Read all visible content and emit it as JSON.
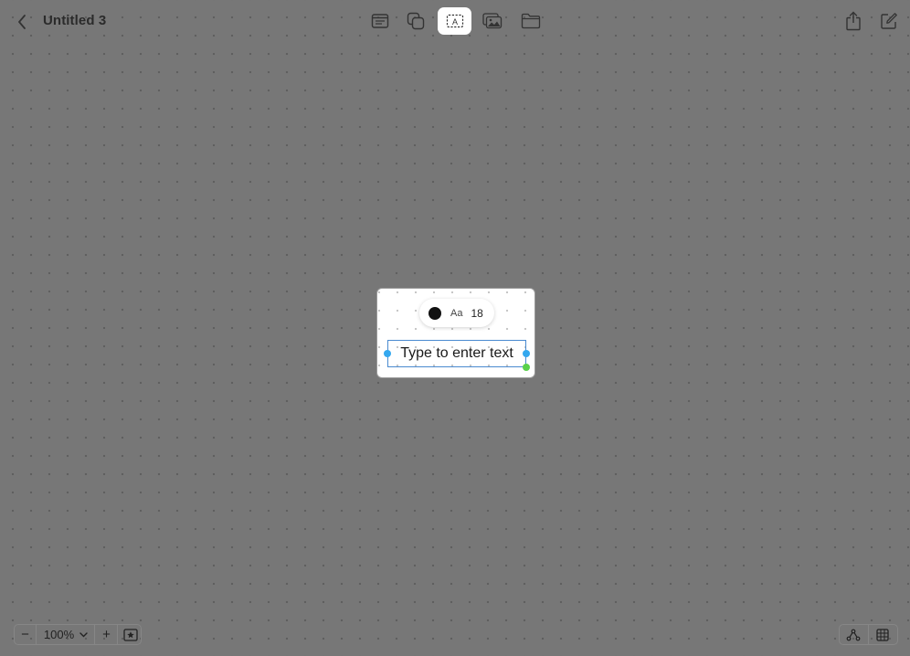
{
  "header": {
    "title": "Untitled 3",
    "tools": [
      {
        "name": "notes-tool",
        "icon": "text-page-icon",
        "active": false
      },
      {
        "name": "shapes-tool",
        "icon": "shapes-icon",
        "active": false
      },
      {
        "name": "text-box-tool",
        "icon": "text-box-icon",
        "active": true
      },
      {
        "name": "media-tool",
        "icon": "photo-icon",
        "active": false
      },
      {
        "name": "files-tool",
        "icon": "folder-icon",
        "active": false
      }
    ],
    "right_icons": [
      "share-icon",
      "compose-icon"
    ]
  },
  "canvas": {
    "card": {
      "format_bar": {
        "color": "#111111",
        "font_label": "Aa",
        "font_size": "18"
      },
      "text_placeholder": "Type to enter text"
    }
  },
  "footer": {
    "zoom_minus": "−",
    "zoom_value": "100%",
    "zoom_plus": "+",
    "right_icons": [
      "connector-icon",
      "grid-icon"
    ]
  },
  "colors": {
    "canvas_bg": "#777777",
    "selection_border": "#4a8ad0",
    "handle": "#34a8ef",
    "corner_handle": "#5ad14a"
  }
}
